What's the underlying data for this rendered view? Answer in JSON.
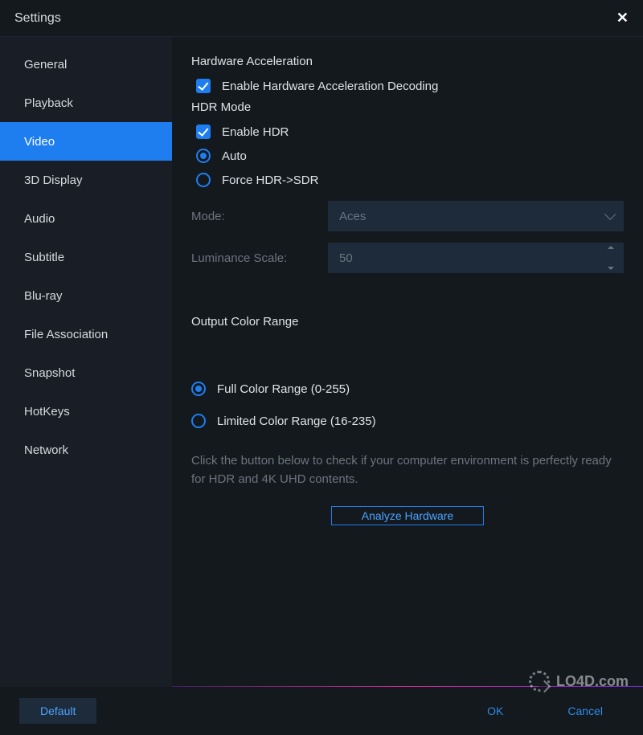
{
  "title": "Settings",
  "sidebar": {
    "items": [
      {
        "label": "General"
      },
      {
        "label": "Playback"
      },
      {
        "label": "Video"
      },
      {
        "label": "3D Display"
      },
      {
        "label": "Audio"
      },
      {
        "label": "Subtitle"
      },
      {
        "label": "Blu-ray"
      },
      {
        "label": "File Association"
      },
      {
        "label": "Snapshot"
      },
      {
        "label": "HotKeys"
      },
      {
        "label": "Network"
      }
    ],
    "activeIndex": 2
  },
  "hw": {
    "section": "Hardware Acceleration",
    "enable": "Enable Hardware Acceleration Decoding",
    "enable_checked": true
  },
  "hdr": {
    "section": "HDR Mode",
    "enable": "Enable HDR",
    "enable_checked": true,
    "opt_auto": "Auto",
    "opt_force": "Force HDR->SDR",
    "selected": "auto",
    "mode_label": "Mode:",
    "mode_value": "Aces",
    "lum_label": "Luminance Scale:",
    "lum_value": "50"
  },
  "ocr": {
    "section": "Output Color Range",
    "opt_full": "Full Color Range (0-255)",
    "opt_limited": "Limited Color Range (16-235)",
    "selected": "full"
  },
  "hint": "Click the button below to check if your computer environment is perfectly ready for HDR and 4K UHD contents.",
  "analyze": "Analyze Hardware",
  "footer": {
    "default": "Default",
    "ok": "OK",
    "cancel": "Cancel"
  },
  "watermark": "LO4D.com"
}
